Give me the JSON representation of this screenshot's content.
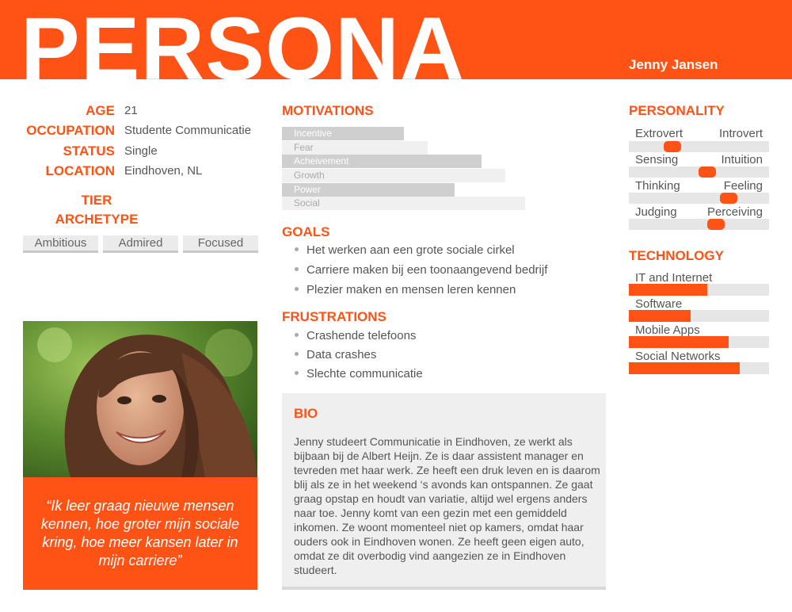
{
  "header": {
    "title": "PERSONA",
    "name": "Jenny Jansen",
    "accent_color": "#ff5215"
  },
  "info": [
    {
      "label": "AGE",
      "value": "21"
    },
    {
      "label": "OCCUPATION",
      "value": "Studente Communicatie"
    },
    {
      "label": "STATUS",
      "value": "Single"
    },
    {
      "label": "LOCATION",
      "value": "Eindhoven, NL"
    }
  ],
  "tier": {
    "title_line1": "TIER",
    "title_line2": "ARCHETYPE",
    "tags": [
      "Ambitious",
      "Admired",
      "Focused"
    ]
  },
  "photo": {
    "icon": "portrait-photo"
  },
  "quote": "“Ik leer graag nieuwe mensen kennen, hoe groter mijn sociale kring, hoe meer kansen later in mijn carriere”",
  "motivations": {
    "title": "MOTIVATIONS",
    "items": [
      {
        "label": "Incentive",
        "level": 0.5
      },
      {
        "label": "Fear",
        "level": 0.6
      },
      {
        "label": "Acheivement",
        "level": 0.82
      },
      {
        "label": "Growth",
        "level": 0.92
      },
      {
        "label": "Power",
        "level": 0.71
      },
      {
        "label": "Social",
        "level": 1.0
      }
    ]
  },
  "goals": {
    "title": "GOALS",
    "items": [
      "Het werken aan een grote sociale cirkel",
      "Carriere maken bij een toonaangevend bedrijf",
      "Plezier maken en mensen leren kennen"
    ]
  },
  "frustrations": {
    "title": "FRUSTRATIONS",
    "items": [
      "Crashende telefoons",
      "Data crashes",
      "Slechte communicatie"
    ]
  },
  "bio": {
    "title": "BIO",
    "text": "Jenny studeert Communicatie in Eindhoven, ze werkt als bijbaan bij de Albert Heijn. Ze is daar assistent manager en tevreden met haar werk. Ze heeft een druk leven en is daarom blij als ze in het weekend ‘s avonds kan ontspannen. Ze gaat graag opstap en houdt van variatie, altijd wel ergens anders naar toe. Jenny komt van een gezin met een gemiddeld inkomen. Ze woont momenteel niet op kamers, omdat haar ouders ook in Eindhoven wonen. Ze heeft geen eigen auto, omdat ze dit overbodig vind aangezien ze in Eindhoven studeert."
  },
  "personality": {
    "title": "PERSONALITY",
    "scales": [
      {
        "left": "Extrovert",
        "right": "Introvert",
        "position": 0.31
      },
      {
        "left": "Sensing",
        "right": "Intuition",
        "position": 0.56
      },
      {
        "left": "Thinking",
        "right": "Feeling",
        "position": 0.71
      },
      {
        "left": "Judging",
        "right": "Perceiving",
        "position": 0.62
      }
    ]
  },
  "technology": {
    "title": "TECHNOLOGY",
    "items": [
      {
        "label": "IT and Internet",
        "level": 0.56
      },
      {
        "label": "Software",
        "level": 0.44
      },
      {
        "label": "Mobile Apps",
        "level": 0.71
      },
      {
        "label": "Social Networks",
        "level": 0.79
      }
    ]
  }
}
